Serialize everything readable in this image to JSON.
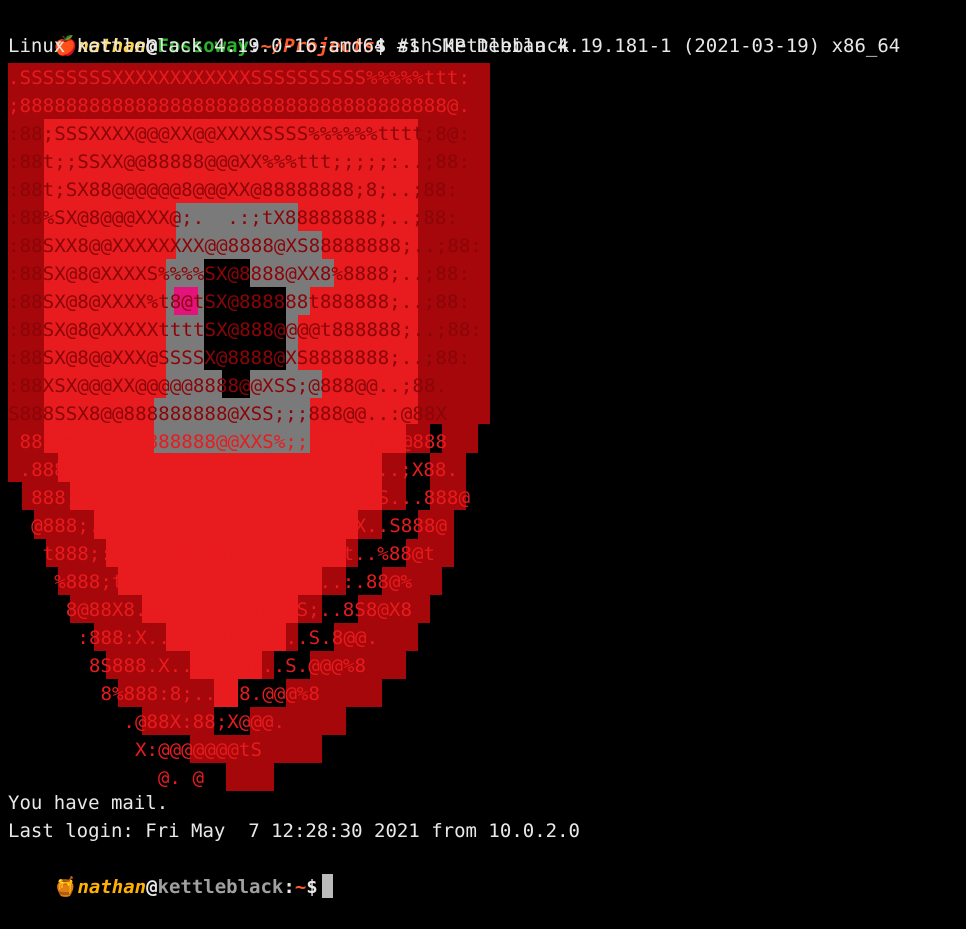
{
  "prompt1": {
    "icon": "apple-icon",
    "user": "nathan",
    "at": "@",
    "host": "Fossoway",
    "sep": ":",
    "path": "~/Projects",
    "dollar": "$",
    "command": " ssh kettleblack"
  },
  "banner": "Linux kettleblack 4.19.0-16-amd64 #1 SMP Debian 4.19.181-1 (2021-03-19) x86_64",
  "ascii_art": [
    ".SSSSSSSSXXXXXXXXXXXXSSSSSSSSSS%%%%%ttt:",
    ";8888888888888888888888888888888888888@.",
    ":88;SSSXXXX@@@XX@@XXXXSSSS%%%%%%tttt;8@:",
    ":88t;;SSXX@@88888@@@XX%%%ttt;;;;;:..;88:",
    ":88t;SX88@@@@@@8@@@XX@88888888;8;..;88:",
    ":88%SX@8@@@XXX@;.  .:;tX88888888;..;88:",
    ":88SXX8@@XXXXXXXX@@8888@XS88888888;..;88:",
    ":88SX@8@XXXXS%%%%SX@8888@XX8%8888;..;88:",
    ":88SX@8@XXXX%t8@tSX@888888t888888;..;88:",
    ":88SX@8@XXXXXttttSX@888@@@@t888888;..;88:",
    ":88SX@8@@XXX@SSSSX@8888@XS8888888;..;88:",
    ":88XSX@@@XX@@@@@8888@@XSS;@888@@..;88.",
    "S888SSX8@@888888888@XSS;;;888@@..:@88X",
    " 888%%SX8888888888@@XXS%;;;:@88t..@888",
    " .888%;t:X888XXXXXXXSSS;;;;;:88S..;X88.",
    "  888;;.;@888@SSSS%;;;;;::;SX88@S...888@",
    "  @888;.:@888%%;;;;;;;;;tS@88XX..S888@",
    "   t888;:.t:888%;@8::8@;S888:t..%88@t",
    "    %888;t:;@tS%;t::%:tS;X@..:.88@%",
    "     8@88X8..;S@88;88t88XS;..8S8@X8",
    "      :888:X..:8;8888;8:..S.8@@.",
    "       8S888.X...%SS%...S.@@@%8",
    "        8%888:8;....8.@@@%8",
    "          .@88X:88;X@@@.",
    "           X:@@@@@@@tS",
    "             @. @"
  ],
  "motd": {
    "mail": "You have mail.",
    "last_login": "Last login: Fri May  7 12:28:30 2021 from 10.0.2.0"
  },
  "prompt2": {
    "icon": "honey-pot-icon",
    "user": "nathan",
    "at": "@",
    "host": "kettleblack",
    "sep": ":",
    "path": "~",
    "dollar": "$"
  },
  "colors": {
    "background": "#000000",
    "shield_outer": "#a5070a",
    "shield_inner": "#e81b1e",
    "shield_gray": "#7a7a7a",
    "shield_dark": "#000000"
  }
}
